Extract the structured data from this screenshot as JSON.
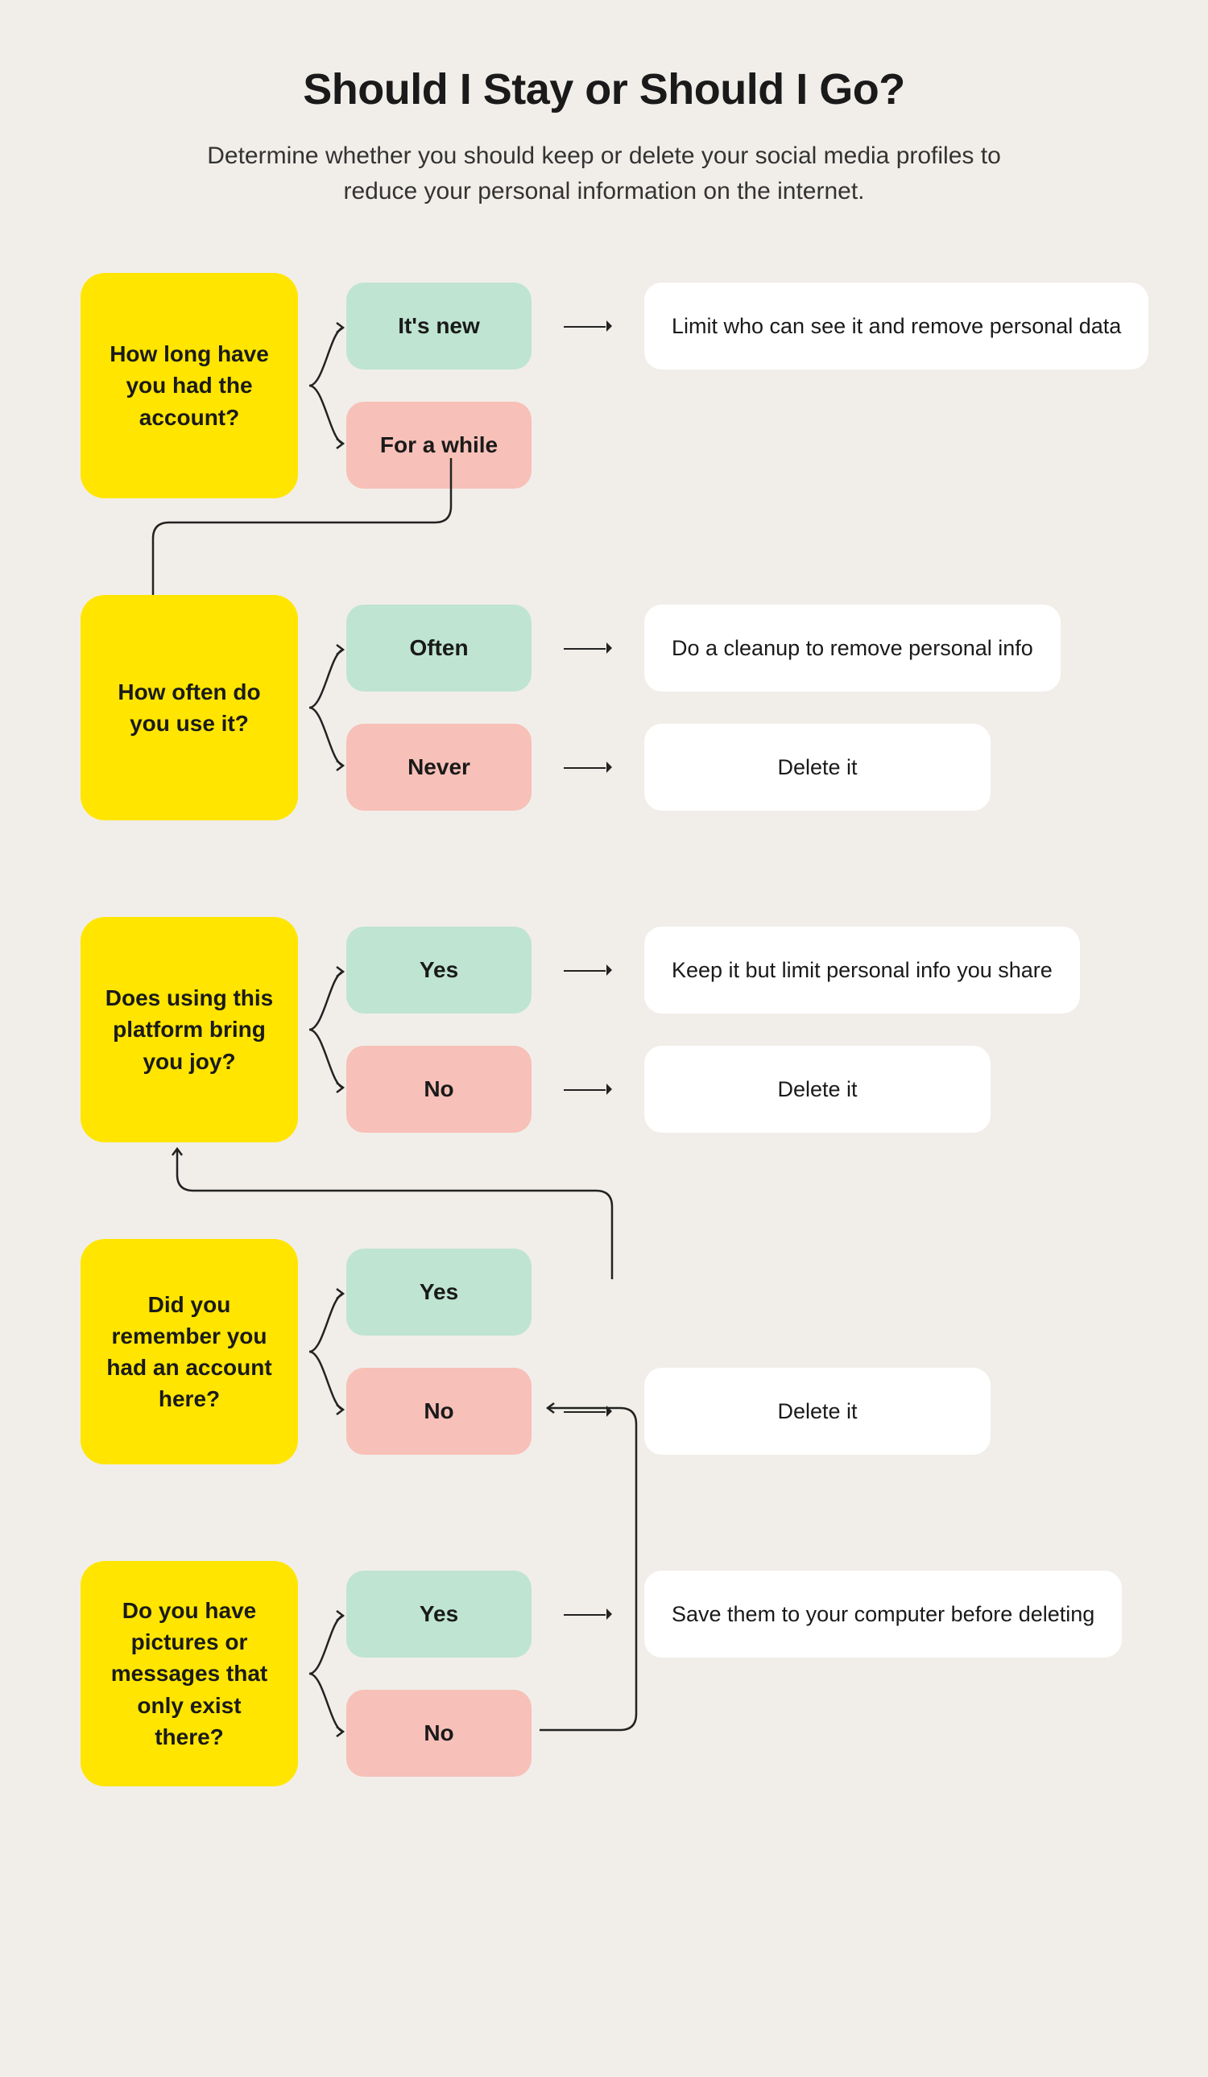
{
  "title": "Should I Stay or Should I Go?",
  "subtitle": "Determine whether you should keep or delete your social media profiles to reduce your personal information on the internet.",
  "colors": {
    "question": "#ffe500",
    "answer_positive": "#bfe4d2",
    "answer_negative": "#f7c0b8",
    "outcome": "#ffffff",
    "background": "#f1eee9",
    "line": "#222222"
  },
  "flow": [
    {
      "id": "duration",
      "question": "How long have you had the account?",
      "answers": [
        {
          "label": "It's new",
          "tone": "positive",
          "outcome": "Limit who can see it and remove personal data"
        },
        {
          "label": "For a while",
          "tone": "negative",
          "next": "frequency"
        }
      ]
    },
    {
      "id": "frequency",
      "question": "How often do you use it?",
      "answers": [
        {
          "label": "Often",
          "tone": "positive",
          "outcome": "Do a cleanup to remove personal info"
        },
        {
          "label": "Never",
          "tone": "negative",
          "outcome": "Delete it"
        }
      ]
    },
    {
      "id": "joy",
      "question": "Does using this platform bring you joy?",
      "answers": [
        {
          "label": "Yes",
          "tone": "positive",
          "outcome": "Keep it but limit personal info you share"
        },
        {
          "label": "No",
          "tone": "negative",
          "outcome": "Delete it"
        }
      ]
    },
    {
      "id": "remember",
      "question": "Did you remember you had an account here?",
      "answers": [
        {
          "label": "Yes",
          "tone": "positive",
          "next": "joy"
        },
        {
          "label": "No",
          "tone": "negative",
          "outcome": "Delete it"
        }
      ]
    },
    {
      "id": "media",
      "question": "Do you have pictures or messages that only exist there?",
      "answers": [
        {
          "label": "Yes",
          "tone": "positive",
          "outcome": "Save them to your computer before deleting"
        },
        {
          "label": "No",
          "tone": "negative",
          "next": "remember"
        }
      ]
    }
  ]
}
